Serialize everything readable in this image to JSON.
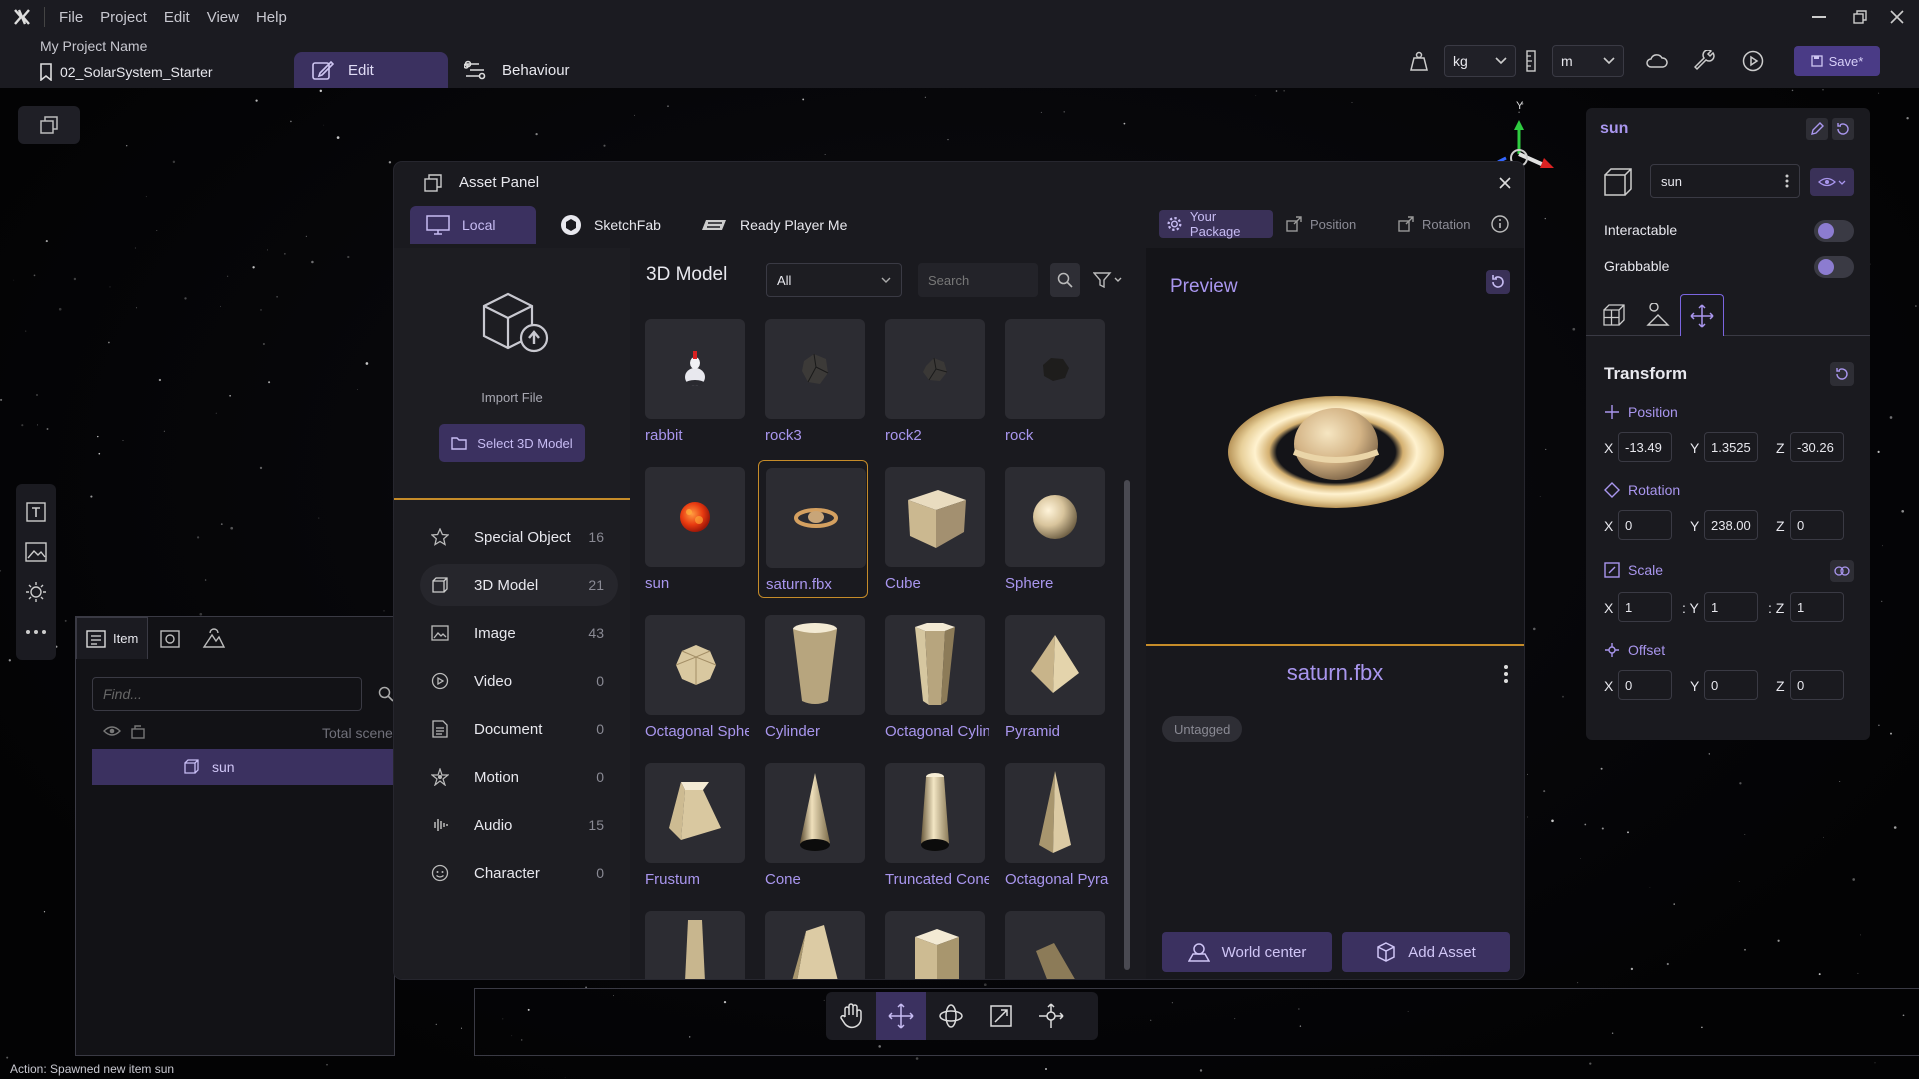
{
  "menu": [
    "File",
    "Project",
    "Edit",
    "View",
    "Help"
  ],
  "header": {
    "project_name": "My Project Name",
    "scene_file": "02_SolarSystem_Starter",
    "tab_edit": "Edit",
    "tab_behaviour": "Behaviour",
    "mass_unit": "kg",
    "length_unit": "m",
    "save_label": "Save*"
  },
  "asset_panel": {
    "title": "Asset Panel",
    "tabs": {
      "local": "Local",
      "sketchfab": "SketchFab",
      "ready_player_me": "Ready Player Me"
    },
    "buttons": {
      "your_package": "Your Package",
      "position": "Position",
      "rotation": "Rotation"
    },
    "import_label": "Import File",
    "select_button": "Select 3D Model",
    "categories": [
      {
        "label": "Special Object",
        "count": "16"
      },
      {
        "label": "3D Model",
        "count": "21"
      },
      {
        "label": "Image",
        "count": "43"
      },
      {
        "label": "Video",
        "count": "0"
      },
      {
        "label": "Document",
        "count": "0"
      },
      {
        "label": "Motion",
        "count": "0"
      },
      {
        "label": "Audio",
        "count": "15"
      },
      {
        "label": "Character",
        "count": "0"
      }
    ],
    "grid_title": "3D Model",
    "filter_value": "All",
    "search_placeholder": "Search",
    "assets": [
      "rabbit",
      "rock3",
      "rock2",
      "rock",
      "sun",
      "saturn.fbx",
      "Cube",
      "Sphere",
      "Octagonal Sphere",
      "Cylinder",
      "Octagonal Cylinder",
      "Pyramid",
      "Frustum",
      "Cone",
      "Truncated Cone",
      "Octagonal Pyramid"
    ],
    "preview_title": "Preview",
    "selected_name": "saturn.fbx",
    "tag": "Untagged",
    "world_center": "World center",
    "add_asset": "Add Asset"
  },
  "hierarchy": {
    "tab_item": "Item",
    "find_placeholder": "Find...",
    "total_label": "Total scene",
    "rows": [
      "sun"
    ]
  },
  "inspector": {
    "title": "sun",
    "name_value": "sun",
    "interactable": "Interactable",
    "grabbable": "Grabbable",
    "transform": "Transform",
    "position_label": "Position",
    "rotation_label": "Rotation",
    "scale_label": "Scale",
    "offset_label": "Offset",
    "position": {
      "x": "-13.49",
      "y": "1.3525",
      "z": "-30.26"
    },
    "rotation": {
      "x": "0",
      "y": "238.00",
      "z": "0"
    },
    "scale": {
      "x": "1",
      "y": "1",
      "z": "1"
    },
    "offset": {
      "x": "0",
      "y": "0",
      "z": "0"
    }
  },
  "gizmo_axis_label": "Y",
  "status": "Action: Spawned new item sun",
  "colors": {
    "accent": "#3b3160",
    "accent_text": "#a996ee",
    "highlight": "#c68c29"
  }
}
